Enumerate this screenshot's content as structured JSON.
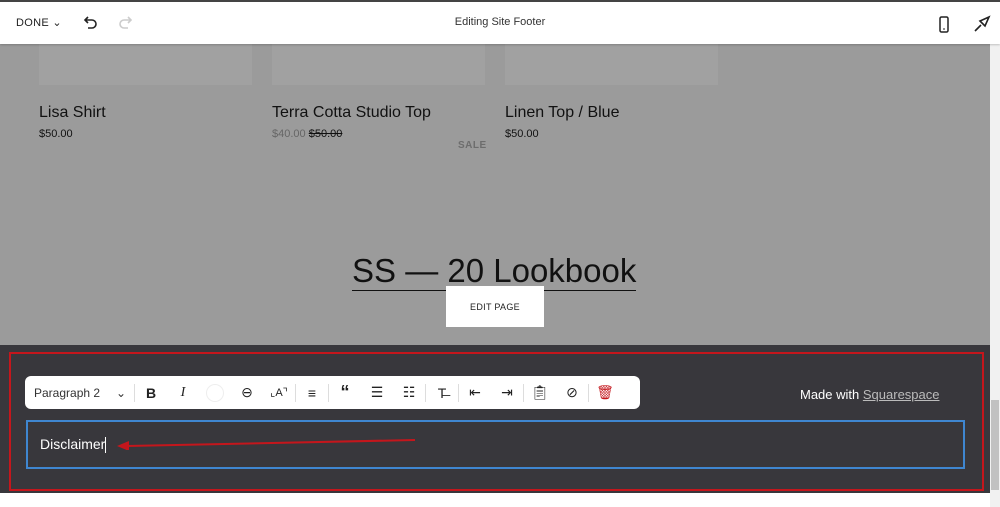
{
  "topbar": {
    "done_label": "DONE",
    "title": "Editing Site Footer",
    "icons": [
      "chevron-down-icon",
      "undo-icon",
      "redo-icon",
      "mobile-preview-icon",
      "design-brush-icon"
    ]
  },
  "products": [
    {
      "name": "Lisa Shirt",
      "price": "$50.00"
    },
    {
      "name": "Terra Cotta Studio Top",
      "price": "$40.00",
      "original_price": "$50.00",
      "badge": "SALE"
    },
    {
      "name": "Linen Top / Blue",
      "price": "$50.00"
    }
  ],
  "lookbook": {
    "heading": "SS — 20 Lookbook",
    "edit_page_label": "EDIT PAGE"
  },
  "footer": {
    "toolbar": {
      "style_select": "Paragraph 2",
      "buttons": [
        "bold",
        "italic",
        "color",
        "link",
        "font-size",
        "align",
        "quote",
        "bulleted-list",
        "numbered-list",
        "strikethrough",
        "outdent",
        "indent",
        "paste-plain-text",
        "clear-formatting",
        "delete"
      ]
    },
    "made_with": "Made with",
    "made_with_link": "Squarespace",
    "text_value": "Disclaimer"
  },
  "colors": {
    "highlight_border": "#c4161c",
    "text_block_border": "#3f86d0",
    "footer_bg": "#38373c",
    "annotation_arrow": "#c4161c"
  }
}
